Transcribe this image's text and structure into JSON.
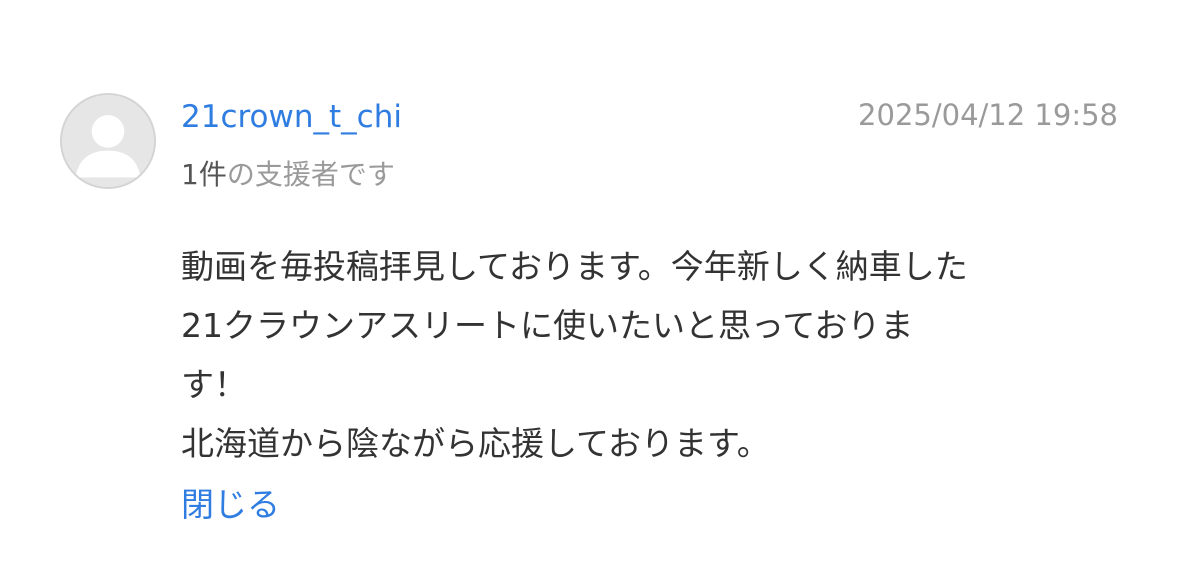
{
  "comment": {
    "avatar_icon": "default-user-icon",
    "username": "21crown_t_chi",
    "timestamp": "2025/04/12 19:58",
    "supporter": {
      "count": "1件",
      "suffix": "の支援者です"
    },
    "body_lines": [
      "動画を毎投稿拝見しております。今年新しく納車した",
      "21クラウンアスリートに使いたいと思っておりま",
      "す！",
      "北海道から陰ながら応援しております。"
    ],
    "close_label": "閉じる"
  },
  "colors": {
    "link": "#2f7de1",
    "muted": "#9a9a9a",
    "text": "#333333",
    "avatar_bg": "#e6e6e6"
  }
}
